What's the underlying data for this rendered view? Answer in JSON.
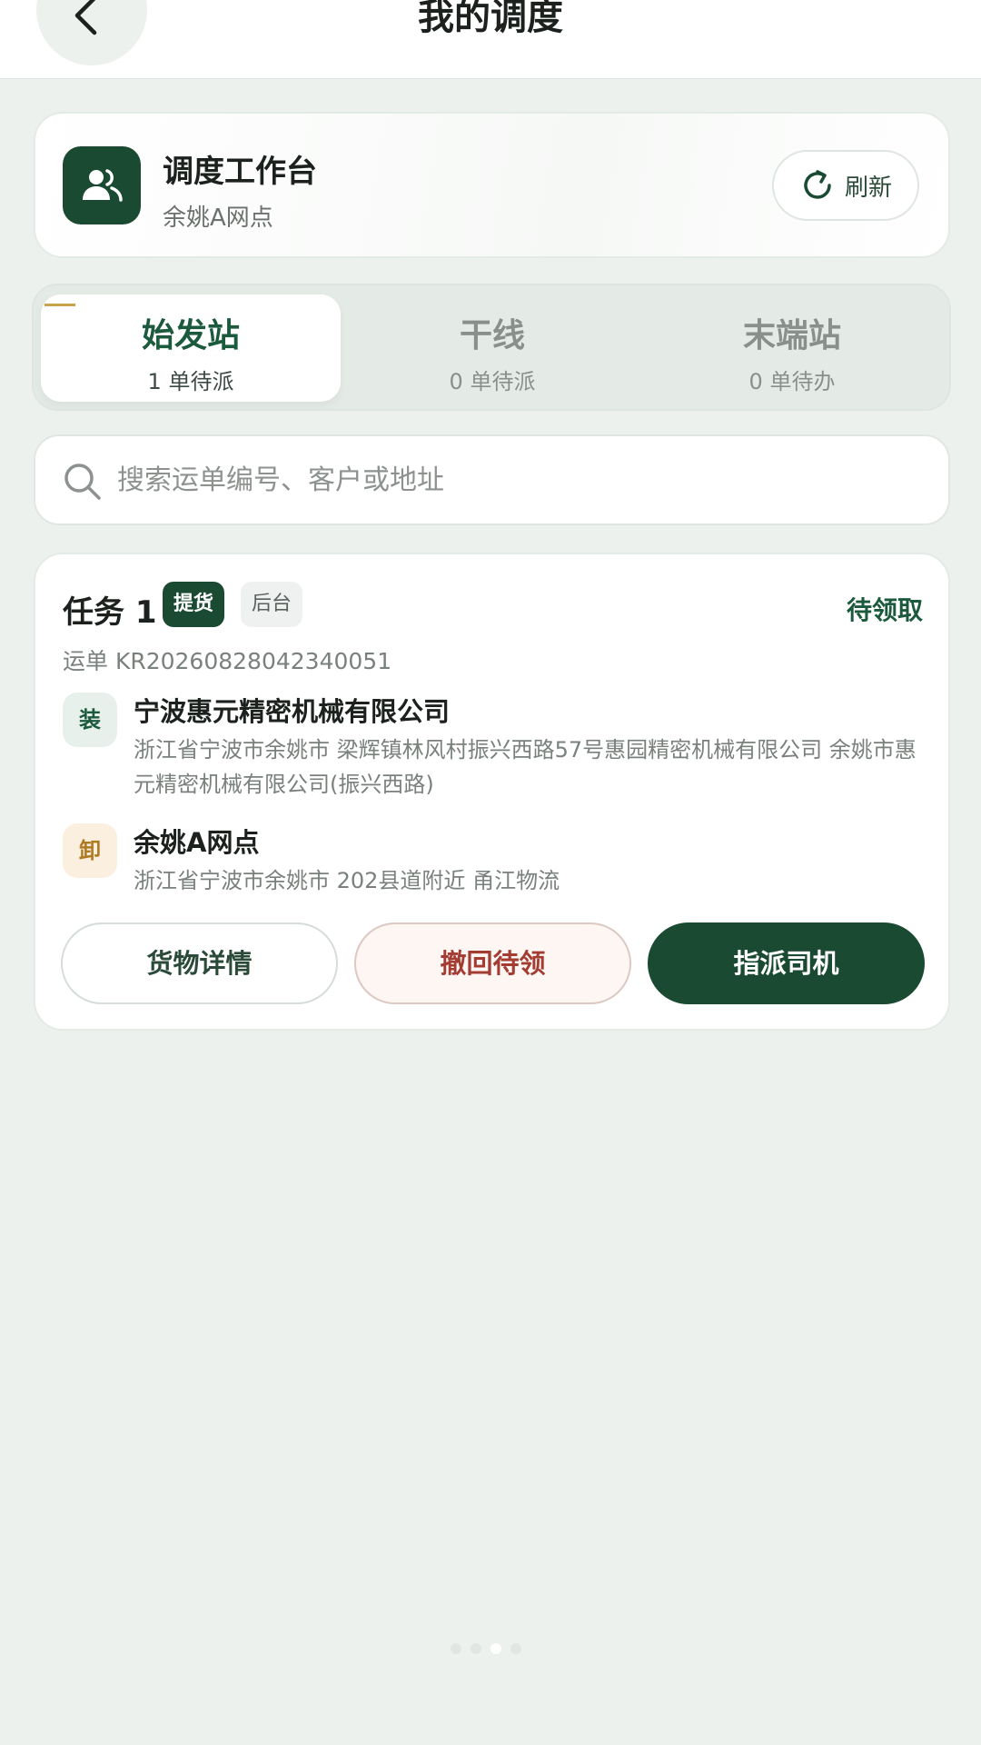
{
  "header": {
    "title": "我的调度",
    "back_icon": "chevron-left-icon"
  },
  "workstation": {
    "title": "调度工作台",
    "subtitle": "余姚A网点",
    "refresh_label": "刷新"
  },
  "tabs": [
    {
      "name": "始发站",
      "count": "1 单待派",
      "active": true
    },
    {
      "name": "干线",
      "count": "0 单待派",
      "active": false
    },
    {
      "name": "末端站",
      "count": "0 单待办",
      "active": false
    }
  ],
  "search": {
    "placeholder": "搜索运单编号、客户或地址",
    "value": ""
  },
  "task": {
    "title": "任务 1",
    "badge_type": "提货",
    "badge_source": "后台",
    "status": "待领取",
    "waybill": "运单 KR20260828042340051",
    "load": {
      "icon_label": "装",
      "name": "宁波惠元精密机械有限公司",
      "address": "浙江省宁波市余姚市 梁辉镇林风村振兴西路57号惠园精密机械有限公司 余姚市惠元精密机械有限公司(振兴西路)"
    },
    "unload": {
      "icon_label": "卸",
      "name": "余姚A网点",
      "address": "浙江省宁波市余姚市 202县道附近 甬江物流"
    },
    "actions": {
      "detail": "货物详情",
      "recall": "撤回待领",
      "assign": "指派司机"
    }
  },
  "page_indicator": {
    "count": 4,
    "current": 3
  },
  "colors": {
    "primary": "#1b4a33",
    "accent_text": "#1b5a3c",
    "danger": "#a33c33",
    "background": "#edf1ee"
  }
}
